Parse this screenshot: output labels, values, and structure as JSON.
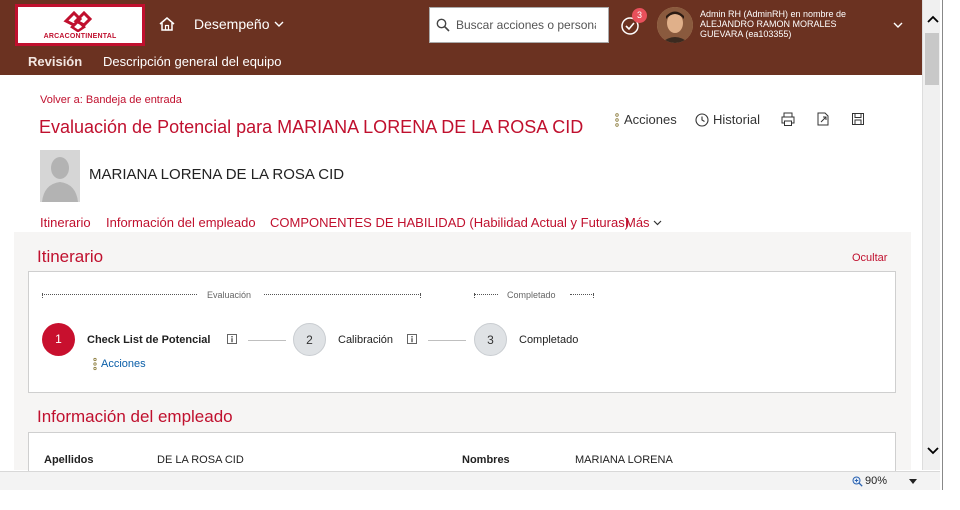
{
  "header": {
    "logo_text": "ARCACONTINENTAL",
    "home_icon": "home-icon",
    "perf_menu_label": "Desempeño",
    "search_placeholder": "Buscar acciones o personas",
    "notification_count": "3",
    "user_line1": "Admin RH (AdminRH) en nombre de",
    "user_line2": "ALEJANDRO RAMON MORALES",
    "user_line3": "GUEVARA (ea103355)",
    "brand_color": "#6b3221"
  },
  "subnav": {
    "items": [
      {
        "label": "Revisión"
      },
      {
        "label": "Descripción general del equipo"
      }
    ]
  },
  "page": {
    "back_link": "Volver a: Bandeja de entrada",
    "title": "Evaluación de Potencial para MARIANA LORENA DE LA ROSA CID",
    "actions_label": "Acciones",
    "history_label": "Historial",
    "employee_name": "MARIANA LORENA DE LA ROSA CID",
    "accent_color": "#c0102e"
  },
  "tabs": [
    {
      "label": "Itinerario"
    },
    {
      "label": "Información del empleado"
    },
    {
      "label": "COMPONENTES DE HABILIDAD (Habilidad Actual y Futuras)"
    },
    {
      "label": "Más"
    }
  ],
  "itinerary": {
    "title": "Itinerario",
    "hide_label": "Ocultar",
    "phases": [
      {
        "label": "Evaluación"
      },
      {
        "label": "Completado"
      }
    ],
    "steps": [
      {
        "number": "1",
        "label": "Check List de Potencial",
        "state": "active"
      },
      {
        "number": "2",
        "label": "Calibración",
        "state": "pending"
      },
      {
        "number": "3",
        "label": "Completado",
        "state": "pending"
      }
    ],
    "actions_link": "Acciones"
  },
  "employee_info": {
    "title": "Información del empleado",
    "fields": [
      {
        "label": "Apellidos",
        "value": "DE LA ROSA CID"
      },
      {
        "label": "Nombres",
        "value": "MARIANA LORENA"
      }
    ]
  },
  "statusbar": {
    "zoom": "90%"
  }
}
